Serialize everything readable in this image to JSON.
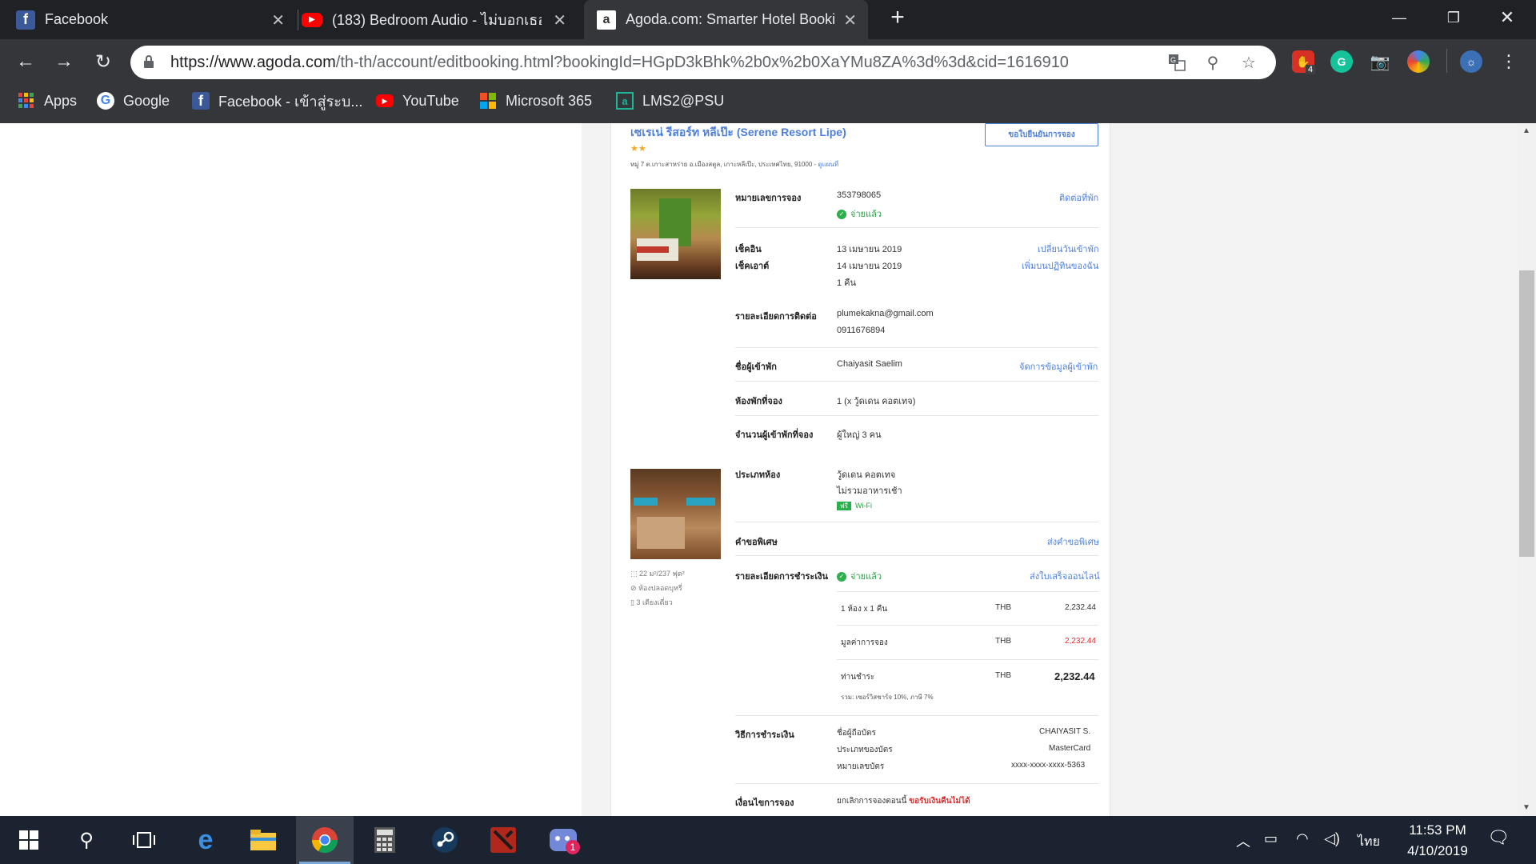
{
  "browser": {
    "tabs": [
      {
        "title": "Facebook",
        "icon": "facebook-icon"
      },
      {
        "title": "(183) Bedroom Audio - ไม่บอกเธอ",
        "icon": "youtube-icon"
      },
      {
        "title": "Agoda.com: Smarter Hotel Booki",
        "icon": "agoda-icon"
      }
    ],
    "url_domain": "https://www.agoda.com",
    "url_path": "/th-th/account/editbooking.html?bookingId=HGpD3kBhk%2b0x%2b0XaYMu8ZA%3d%3d&cid=1616910",
    "extension_badge": "4",
    "bookmarks": [
      {
        "label": "Apps",
        "icon": "apps-grid-icon"
      },
      {
        "label": "Google",
        "icon": "google-icon"
      },
      {
        "label": "Facebook - เข้าสู่ระบ...",
        "icon": "facebook-icon"
      },
      {
        "label": "YouTube",
        "icon": "youtube-icon"
      },
      {
        "label": "Microsoft 365",
        "icon": "microsoft-icon"
      },
      {
        "label": "LMS2@PSU",
        "icon": "lms-icon"
      }
    ]
  },
  "hotel": {
    "name": "เซเรเน่ รีสอร์ท หลีเป๊ะ (Serene Resort Lipe)",
    "stars": "★★",
    "address": "หมู่ 7 ต.เกาะสาหร่าย อ.เมืองสตูล, เกาะหลีเป๊ะ, ประเทศไทย, 91000",
    "map_link": "ดูแผนที่",
    "confirm_button": "ขอใบยืนยันการจอง"
  },
  "booking": {
    "booking_no_label": "หมายเลขการจอง",
    "booking_no": "353798065",
    "paid_status": "จ่ายแล้ว",
    "contact_link": "ติดต่อที่พัก",
    "checkin_label": "เช็คอิน",
    "checkin": "13 เมษายน 2019",
    "checkout_label": "เช็คเอาต์",
    "checkout": "14 เมษายน 2019",
    "nights": "1 คืน",
    "change_dates_link": "เปลี่ยนวันเข้าพัก",
    "add_calendar_link": "เพิ่มบนปฏิทินของฉัน",
    "contact_label": "รายละเอียดการติดต่อ",
    "email": "plumekakna@gmail.com",
    "phone": "0911676894",
    "guest_label": "ชื่อผู้เข้าพัก",
    "guest": "Chaiyasit Saelim",
    "manage_guest_link": "จัดการข้อมูลผู้เข้าพัก",
    "rooms_label": "ห้องพักที่จอง",
    "rooms": "1 (x วู้ดเดน คอตเทจ)",
    "occupancy_label": "จำนวนผู้เข้าพักที่จอง",
    "occupancy": "ผู้ใหญ่ 3 คน",
    "room_type_label": "ประเภทห้อง",
    "room_type": "วู้ดเดน คอตเทจ",
    "breakfast": "ไม่รวมอาหารเช้า",
    "wifi_badge": "ฟรี",
    "wifi": "Wi-Fi",
    "room_size": "22 ม²/237 ฟุต²",
    "room_nonsmoking": "ห้องปลอดบุหรี่",
    "room_beds": "3 เตียงเดี่ยว",
    "special_label": "คำขอพิเศษ",
    "special_link": "ส่งคำขอพิเศษ",
    "payment_label": "รายละเอียดการชำระเงิน",
    "payment_status": "จ่ายแล้ว",
    "receipt_link": "ส่งใบเสร็จออนไลน์",
    "line1_label": "1 ห้อง x 1 คืน",
    "currency": "THB",
    "line1_amount": "2,232.44",
    "line2_label": "มูลค่าการจอง",
    "line2_amount": "2,232.44",
    "line3_label": "ท่านชำระ",
    "line3_amount": "2,232.44",
    "tax_note": "รวม: เซอร์วิสชาร์จ 10%, ภาษี 7%",
    "method_label": "วิธีการชำระเงิน",
    "cardholder_label": "ชื่อผู้ถือบัตร",
    "cardholder": "CHAIYASIT S.",
    "cardtype_label": "ประเภทของบัตร",
    "cardtype": "MasterCard",
    "cardno_label": "หมายเลขบัตร",
    "cardno": "xxxx-xxxx-xxxx-5363",
    "terms_label": "เงื่อนไขการจอง",
    "terms_prefix": "ยกเลิกการจองตอนนี้",
    "terms_red": "ขอรับเงินคืนไม่ได้"
  },
  "taskbar": {
    "time": "11:53 PM",
    "date": "4/10/2019",
    "lang": "ไทย",
    "discord_badge": "1"
  }
}
